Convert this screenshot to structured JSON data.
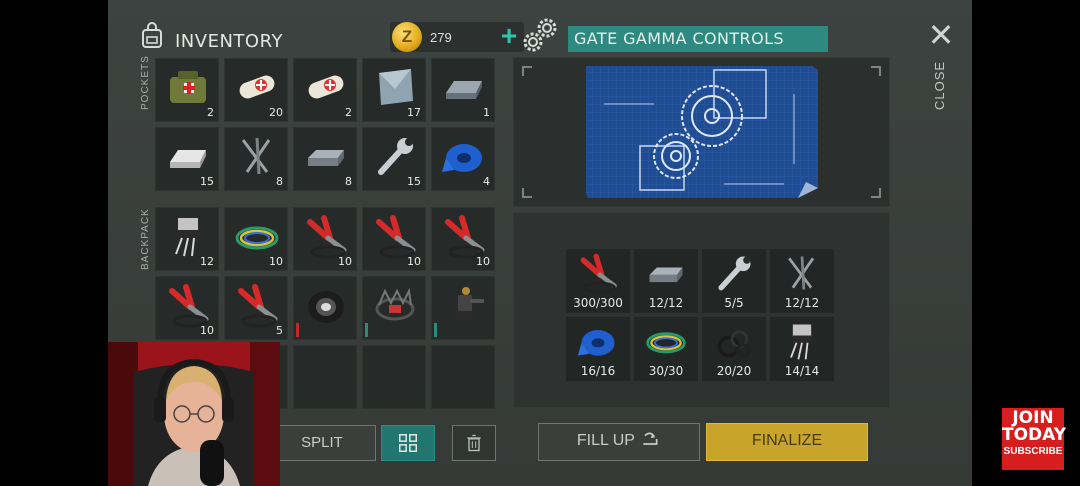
{
  "inventory": {
    "title": "INVENTORY",
    "coins": "279",
    "coin_symbol": "Z",
    "add_symbol": "+",
    "pockets_label": "POCKETS",
    "backpack_label": "BACKPACK",
    "pockets": [
      {
        "icon": "medkit-bag-icon",
        "qty": "2"
      },
      {
        "icon": "bandage-icon",
        "qty": "20"
      },
      {
        "icon": "bandage-icon",
        "qty": "2"
      },
      {
        "icon": "metal-plate-icon",
        "qty": "17"
      },
      {
        "icon": "iron-ingot-icon",
        "qty": "1"
      },
      {
        "icon": "silver-ingot-icon",
        "qty": "15"
      },
      {
        "icon": "nails-icon",
        "qty": "8"
      },
      {
        "icon": "steel-bar-icon",
        "qty": "8"
      },
      {
        "icon": "wrench-icon",
        "qty": "15"
      },
      {
        "icon": "tape-icon",
        "qty": "4"
      }
    ],
    "backpack": [
      {
        "icon": "transistor-icon",
        "qty": "12"
      },
      {
        "icon": "wires-icon",
        "qty": "10"
      },
      {
        "icon": "pliers-icon",
        "qty": "10"
      },
      {
        "icon": "pliers-icon",
        "qty": "10"
      },
      {
        "icon": "pliers-icon",
        "qty": "10"
      },
      {
        "icon": "pliers-icon",
        "qty": "10"
      },
      {
        "icon": "pliers-icon",
        "qty": "5"
      },
      {
        "icon": "tire-wheel-icon",
        "qty": ""
      },
      {
        "icon": "bear-trap-icon",
        "qty": ""
      },
      {
        "icon": "turret-icon",
        "qty": ""
      },
      {
        "icon": "",
        "qty": ""
      },
      {
        "icon": "",
        "qty": ""
      },
      {
        "icon": "",
        "qty": ""
      },
      {
        "icon": "",
        "qty": ""
      },
      {
        "icon": "",
        "qty": ""
      }
    ],
    "split_label": "SPLIT"
  },
  "crafting": {
    "title": "GATE GAMMA CONTROLS",
    "close_label": "CLOSE",
    "requirements": [
      {
        "icon": "pliers-icon",
        "count": "300/300"
      },
      {
        "icon": "steel-bar-icon",
        "count": "12/12"
      },
      {
        "icon": "wrench-icon",
        "count": "5/5"
      },
      {
        "icon": "nails-icon",
        "count": "12/12"
      },
      {
        "icon": "tape-icon",
        "count": "16/16"
      },
      {
        "icon": "wires-icon",
        "count": "30/30"
      },
      {
        "icon": "rubber-rings-icon",
        "count": "20/20"
      },
      {
        "icon": "transistor-icon",
        "count": "14/14"
      }
    ],
    "fill_up_label": "FILL UP",
    "finalize_label": "FINALIZE"
  },
  "promo": {
    "line1": "JOIN",
    "line2": "TODAY",
    "line3": "SUBSCRIBE"
  },
  "colors": {
    "accent": "#2c8a80",
    "finalize": "#c8a42a",
    "durability_red": "#c0282a",
    "durability_teal": "#2a8a7e"
  }
}
